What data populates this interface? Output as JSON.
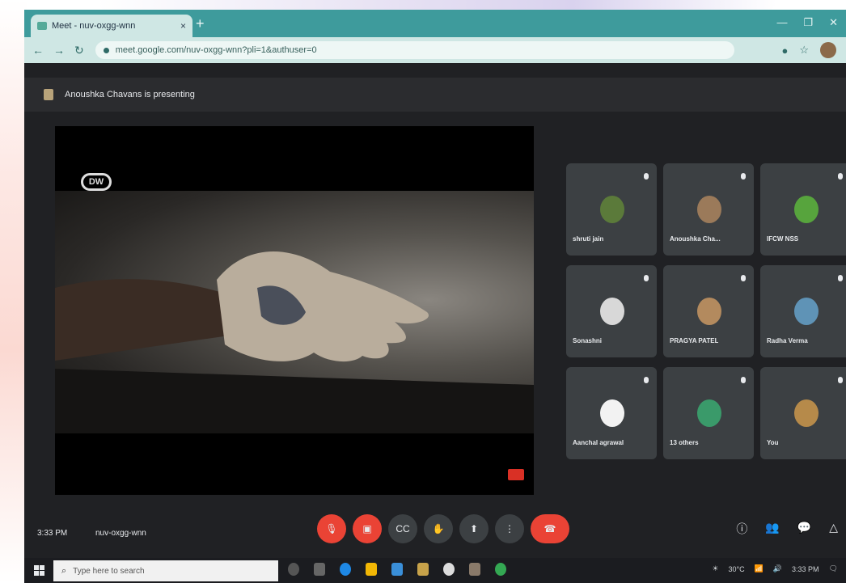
{
  "browser": {
    "tab_title": "Meet - nuv-oxgg-wnn",
    "tab_close": "×",
    "new_tab": "+",
    "url": "meet.google.com/nuv-oxgg-wnn?pli=1&authuser=0",
    "window_controls": [
      "—",
      "❐",
      "✕"
    ]
  },
  "meet": {
    "presenting_text": "Anoushka Chavans is presenting",
    "logo_text": "DW",
    "participants": [
      {
        "name": "shruti jain",
        "avatar_color": "#5b7a3a"
      },
      {
        "name": "Anoushka Cha...",
        "avatar_color": "#9b7a5a"
      },
      {
        "name": "IFCW NSS",
        "avatar_color": "#57a43d"
      },
      {
        "name": "Sonashni",
        "avatar_color": "#d8d8d8"
      },
      {
        "name": "PRAGYA PATEL",
        "avatar_color": "#b38a5e"
      },
      {
        "name": "Radha Verma",
        "avatar_color": "#5f93b6"
      },
      {
        "name": "Aanchal agrawal",
        "avatar_color": "#f2f2f2"
      },
      {
        "name": "13 others",
        "avatar_color": "#3a9a6a"
      },
      {
        "name": "You",
        "avatar_color": "#b68a4a"
      }
    ],
    "time": "3:33 PM",
    "meeting_code": "nuv-oxgg-wnn",
    "controls": [
      "mic-off",
      "camera-off",
      "captions",
      "raise-hand",
      "present",
      "more"
    ]
  },
  "taskbar": {
    "search_placeholder": "Type here to search",
    "tray_text": "30°C",
    "clock_time": "3:33 PM"
  }
}
